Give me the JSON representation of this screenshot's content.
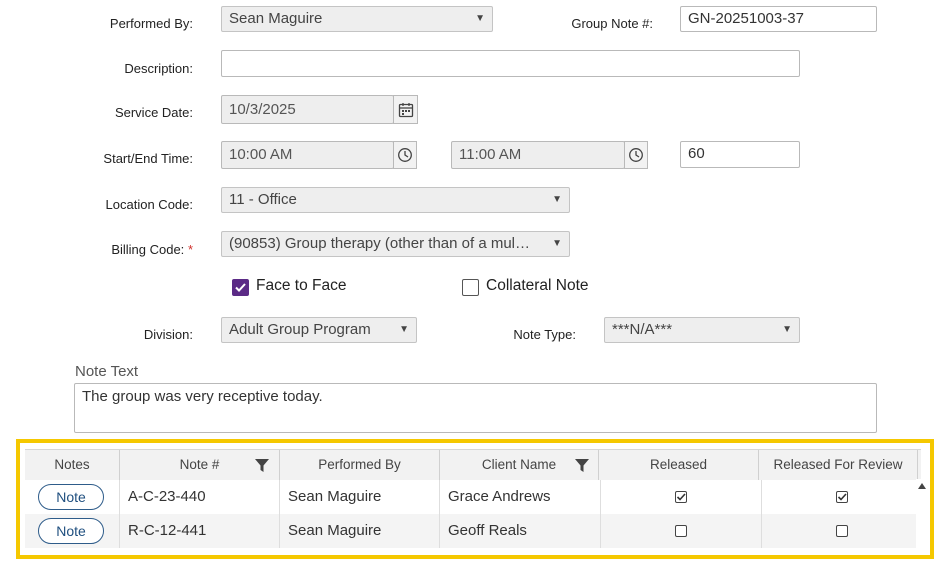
{
  "form": {
    "performed_by_label": "Performed By:",
    "performed_by_value": "Sean Maguire",
    "group_note_label": "Group Note #:",
    "group_note_value": "GN-20251003-37",
    "description_label": "Description:",
    "description_value": "",
    "service_date_label": "Service Date:",
    "service_date_value": "10/3/2025",
    "start_end_label": "Start/End Time:",
    "start_time_value": "10:00 AM",
    "end_time_value": "11:00 AM",
    "duration_value": "60",
    "location_label": "Location Code:",
    "location_value": "11 - Office",
    "billing_label": "Billing Code:",
    "billing_required": "*",
    "billing_value": "(90853) Group therapy (other than of a mul…",
    "face_to_face_label": "Face to Face",
    "face_to_face_checked": true,
    "collateral_label": "Collateral Note",
    "collateral_checked": false,
    "division_label": "Division:",
    "division_value": "Adult Group Program",
    "note_type_label": "Note Type:",
    "note_type_value": "***N/A***",
    "note_text_label": "Note Text",
    "note_text_value": "The group was very receptive today."
  },
  "grid": {
    "columns": [
      "Notes",
      "Note #",
      "Performed By",
      "Client Name",
      "Released",
      "Released For Review"
    ],
    "note_button_label": "Note",
    "rows": [
      {
        "note_num": "A-C-23-440",
        "performed_by": "Sean Maguire",
        "client": "Grace Andrews",
        "released": true,
        "released_for_review": true
      },
      {
        "note_num": "R-C-12-441",
        "performed_by": "Sean Maguire",
        "client": "Geoff Reals",
        "released": false,
        "released_for_review": false
      }
    ]
  },
  "colors": {
    "accent_purple": "#5b2a86",
    "highlight_yellow": "#f5c800",
    "link_blue": "#1f4f7f"
  }
}
